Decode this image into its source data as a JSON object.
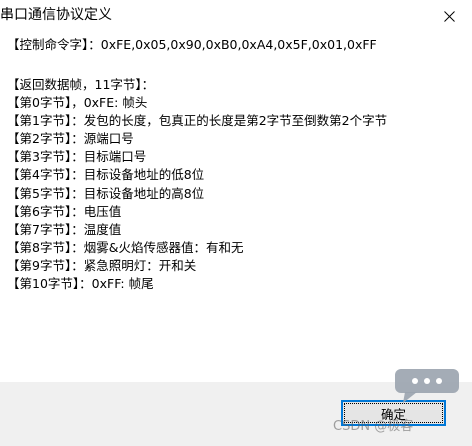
{
  "window": {
    "title": "串口通信协议定义",
    "close_icon": "close-icon"
  },
  "content": {
    "command": "【控制命令字】：0xFE,0x05,0x90,0xB0,0xA4,0x5F,0x01,0xFF",
    "lines": [
      "【返回数据帧，11字节】：",
      "【第0字节】，0xFE: 帧头",
      "【第1字节】：发包的长度，包真正的长度是第2字节至倒数第2个字节",
      "【第2字节】：源端口号",
      "【第3字节】：目标端口号",
      "【第4字节】：目标设备地址的低8位",
      "【第5字节】：目标设备地址的高8位",
      "【第6字节】：电压值",
      "【第7字节】：温度值",
      "【第8字节】：烟雾&火焰传感器值：有和无",
      "【第9字节】：紧急照明灯：开和关",
      "【第10字节】：0xFF: 帧尾"
    ]
  },
  "footer": {
    "ok_label": "确定"
  },
  "overlay": {
    "chat_icon": "chat-bubble-icon",
    "watermark": "CSDN @极客"
  },
  "colors": {
    "background": "#ffffff",
    "footer_bg": "#f0f0f0",
    "button_border": "#0078d7",
    "button_bg": "#e5e5e5"
  }
}
